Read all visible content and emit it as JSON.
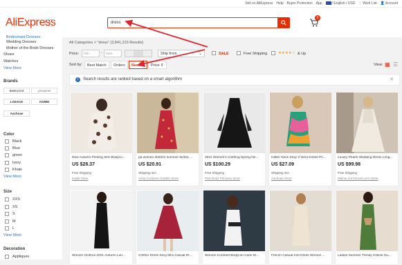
{
  "topbar": {
    "sell": "Sell on AliExpress",
    "help": "Help",
    "protection": "Buyer Protection",
    "app": "App",
    "lang": "/ English / USD",
    "wishlist": "Wish List",
    "account": "Account"
  },
  "header": {
    "logo": "AliExpress",
    "search_value": "dress",
    "cart_count": "0"
  },
  "sidebar": {
    "categories": [
      "Bridesmaid Dresses",
      "Wedding Dresses",
      "Mother of the Bride Dresses",
      "Shoes",
      "Watches"
    ],
    "view_more": "View More",
    "brands_title": "Brands",
    "brands": [
      "BeBeyond",
      "yinsaimei",
      "LAEACE",
      "AGMEI",
      "Aachoae"
    ],
    "color_title": "Color",
    "colors": [
      "Black",
      "Blue",
      "green",
      "Ivory",
      "Khaki"
    ],
    "size_title": "Size",
    "sizes": [
      "XXS",
      "XS",
      "S",
      "M",
      "L"
    ],
    "decoration_title": "Decoration",
    "decorations": [
      "Appliques"
    ]
  },
  "main": {
    "breadcrumb": "All Categories > \"dress\" (2,841,223 Results)",
    "price_label": "Price:",
    "price_min": "min",
    "price_max": "max",
    "ship_from": "Ship from",
    "sale": "SALE",
    "free_shipping": "Free Shipping",
    "stars_up": "& Up",
    "sort_by": "Sort by:",
    "sort_options": [
      "Best Match",
      "Orders",
      "Newest",
      "Price"
    ],
    "view_label": "View:",
    "notice": "Search results are ranked based on a smart algorithm"
  },
  "products": [
    {
      "title": "New Autumn Printing Slim Bodyco...",
      "price": "US $26.37",
      "shipping": "Free Shipping",
      "store": "Kaide Store"
    },
    {
      "title": "pa women 202021 summer bimba ...",
      "price": "US $20.91",
      "shipping": "Shipping incl.",
      "store": "Anna Costume Garden Store"
    },
    {
      "title": "2021 Women's Clothing Spring Ne...",
      "price": "US $100.29",
      "shipping": "Free Shipping",
      "store": "Pink Rose Princess Store"
    },
    {
      "title": "Halter Neck Sexy V Neck Dress Pri...",
      "price": "US $27.09",
      "shipping": "Shipping incl.",
      "store": "Aachoae Store"
    },
    {
      "title": "Luxury Pearls Wedding Dress Long...",
      "price": "US $99.98",
      "shipping": "Free Shipping",
      "store": "Melma not formal Lon's Store"
    }
  ],
  "products_row2": [
    {
      "title": "Women Clothes 2021 Autumn Lon..."
    },
    {
      "title": "Chiffon Dress Sexy Mini Casual Dr..."
    },
    {
      "title": "Women Contrast Bodycon Cami M..."
    },
    {
      "title": "French Casual Knit Dress Women ..."
    },
    {
      "title": "Ladies Summer Trendy Hollow Ou..."
    }
  ],
  "colors": {
    "brand": "#e62e04",
    "link": "#2a6ebb",
    "annotation": "#e0242e"
  }
}
